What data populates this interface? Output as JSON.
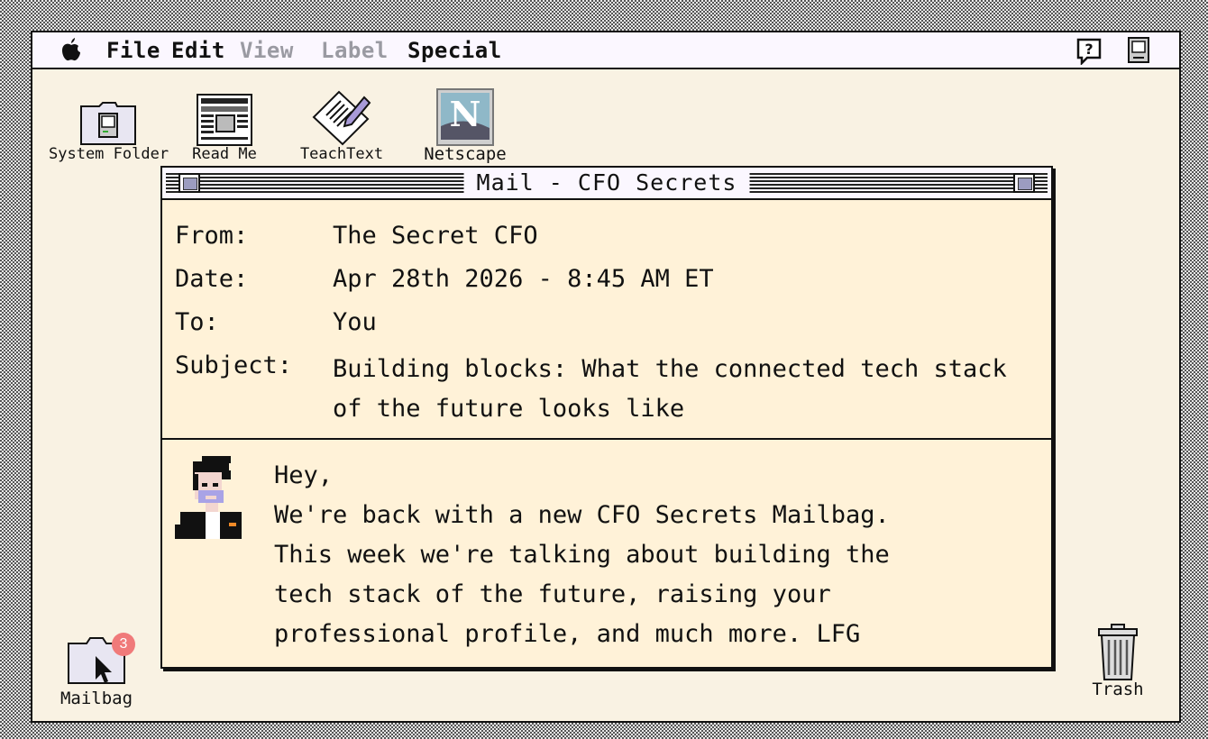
{
  "menubar": {
    "apple_icon": "apple-icon",
    "items": [
      {
        "label": "File",
        "enabled": true
      },
      {
        "label": "Edit",
        "enabled": true
      },
      {
        "label": "View",
        "enabled": false
      },
      {
        "label": "Label",
        "enabled": false
      },
      {
        "label": "Special",
        "enabled": true
      }
    ],
    "help_icon": "help-balloon-icon",
    "app_icon": "mac-computer-icon"
  },
  "desktop": {
    "icons": [
      {
        "label": "System Folder",
        "icon": "system-folder-icon"
      },
      {
        "label": "Read Me",
        "icon": "newspaper-icon"
      },
      {
        "label": "TeachText",
        "icon": "teachtext-icon"
      },
      {
        "label": "Netscape",
        "icon": "netscape-icon"
      }
    ],
    "mailbag": {
      "label": "Mailbag",
      "badge": "3",
      "icon": "folder-icon"
    },
    "trash": {
      "label": "Trash",
      "icon": "trash-icon"
    }
  },
  "window": {
    "title": "Mail - CFO Secrets",
    "headers": {
      "from_label": "From:",
      "from_value": "The Secret CFO",
      "date_label": "Date:",
      "date_value": "Apr 28th 2026 - 8:45 AM ET",
      "to_label": "To:",
      "to_value": "You",
      "subject_label": "Subject:",
      "subject_value": "Building blocks: What the connected tech stack of the future looks like"
    },
    "body": {
      "greeting": "Hey,",
      "text": "We're back with a new CFO Secrets Mailbag.\nThis week we're talking about building the\ntech stack of the future, raising your\nprofessional profile, and much more. LFG"
    }
  },
  "colors": {
    "desktop": "#f9f2e3",
    "window_bg": "#fff2d8",
    "badge": "#f07a7a"
  }
}
